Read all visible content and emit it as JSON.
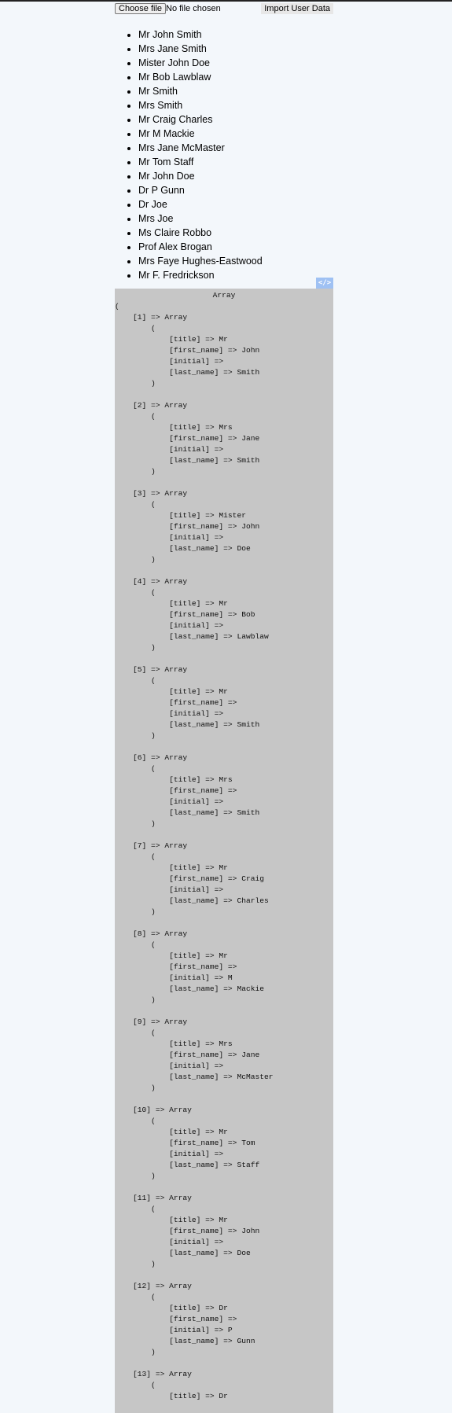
{
  "form": {
    "choose_file_label": "Choose file",
    "file_status": "No file chosen",
    "import_button_label": "Import User Data"
  },
  "names": [
    "Mr John Smith",
    "Mrs Jane Smith",
    "Mister John Doe",
    "Mr Bob Lawblaw",
    "Mr Smith",
    "Mrs Smith",
    "Mr Craig Charles",
    "Mr M Mackie",
    "Mrs Jane McMaster",
    "Mr Tom Staff",
    "Mr John Doe",
    "Dr P Gunn",
    "Dr Joe",
    "Mrs Joe",
    "Ms Claire Robbo",
    "Prof Alex Brogan",
    "Mrs Faye Hughes-Eastwood",
    "Mr F. Fredrickson"
  ],
  "code_toggle_label": "</>",
  "dump": {
    "title": "Array",
    "open_paren": "(",
    "entries": [
      {
        "index": "1",
        "title": "Mr",
        "first_name": "John",
        "initial": "",
        "last_name": "Smith"
      },
      {
        "index": "2",
        "title": "Mrs",
        "first_name": "Jane",
        "initial": "",
        "last_name": "Smith"
      },
      {
        "index": "3",
        "title": "Mister",
        "first_name": "John",
        "initial": "",
        "last_name": "Doe"
      },
      {
        "index": "4",
        "title": "Mr",
        "first_name": "Bob",
        "initial": "",
        "last_name": "Lawblaw"
      },
      {
        "index": "5",
        "title": "Mr",
        "first_name": "",
        "initial": "",
        "last_name": "Smith"
      },
      {
        "index": "6",
        "title": "Mrs",
        "first_name": "",
        "initial": "",
        "last_name": "Smith"
      },
      {
        "index": "7",
        "title": "Mr",
        "first_name": "Craig",
        "initial": "",
        "last_name": "Charles"
      },
      {
        "index": "8",
        "title": "Mr",
        "first_name": "",
        "initial": "M",
        "last_name": "Mackie"
      },
      {
        "index": "9",
        "title": "Mrs",
        "first_name": "Jane",
        "initial": "",
        "last_name": "McMaster"
      },
      {
        "index": "10",
        "title": "Mr",
        "first_name": "Tom",
        "initial": "",
        "last_name": "Staff"
      },
      {
        "index": "11",
        "title": "Mr",
        "first_name": "John",
        "initial": "",
        "last_name": "Doe"
      },
      {
        "index": "12",
        "title": "Dr",
        "first_name": "",
        "initial": "P",
        "last_name": "Gunn"
      },
      {
        "index": "13",
        "title": "Dr",
        "first_name": null,
        "initial": null,
        "last_name": null
      }
    ]
  },
  "colors": {
    "page_background": "#f3f7fb",
    "dump_background": "#c6c6c6",
    "code_toggle_background": "#9fc1f3"
  }
}
